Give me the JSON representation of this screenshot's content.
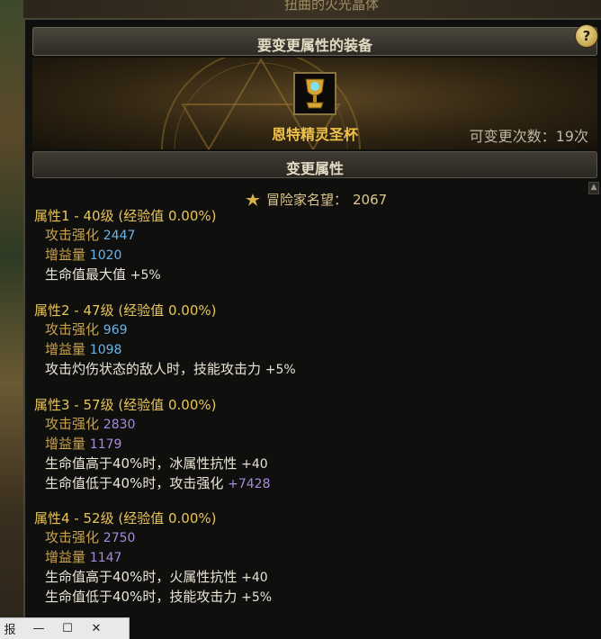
{
  "background": {
    "top_title": "扭曲的火光晶体"
  },
  "header": {
    "title": "要变更属性的装备",
    "help_label": "?"
  },
  "equipment": {
    "name": "恩特精灵圣杯",
    "change_count_text": "可变更次数：19次"
  },
  "subheader": {
    "title": "变更属性"
  },
  "fame": {
    "label": "冒险家名望：",
    "value": "2067"
  },
  "attributes": [
    {
      "title": "属性1 - 40级 (经验值 0.00%)",
      "attack_label": "攻击强化",
      "attack_value": "2447",
      "gain_label": "增益量",
      "gain_value": "1020",
      "effects": [
        {
          "text": "生命值最大值",
          "value": "+5%"
        }
      ]
    },
    {
      "title": "属性2 - 47级 (经验值 0.00%)",
      "attack_label": "攻击强化",
      "attack_value": "969",
      "gain_label": "增益量",
      "gain_value": "1098",
      "effects": [
        {
          "text": "攻击灼伤状态的敌人时，技能攻击力",
          "value": "+5%"
        }
      ]
    },
    {
      "title": "属性3 - 57级 (经验值 0.00%)",
      "attack_label": "攻击强化",
      "attack_value": "2830",
      "gain_label": "增益量",
      "gain_value": "1179",
      "effects": [
        {
          "text": "生命值高于40%时，冰属性抗性",
          "value": "+40"
        },
        {
          "text": "生命值低于40%时，攻击强化",
          "value": "+7428"
        }
      ]
    },
    {
      "title": "属性4 - 52级 (经验值 0.00%)",
      "attack_label": "攻击强化",
      "attack_value": "2750",
      "gain_label": "增益量",
      "gain_value": "1147",
      "effects": [
        {
          "text": "生命值高于40%时，火属性抗性",
          "value": "+40"
        },
        {
          "text": "生命值低于40%时，技能攻击力",
          "value": "+5%"
        }
      ]
    }
  ],
  "window_strip": {
    "label": "报",
    "minimize": "—",
    "maximize": "☐",
    "close": "✕"
  },
  "colors": {
    "title_gold": "#e8c45a",
    "value_blue": "#6bb4e8",
    "value_purple": "#a78ae0",
    "item_name": "#f0c24a"
  }
}
